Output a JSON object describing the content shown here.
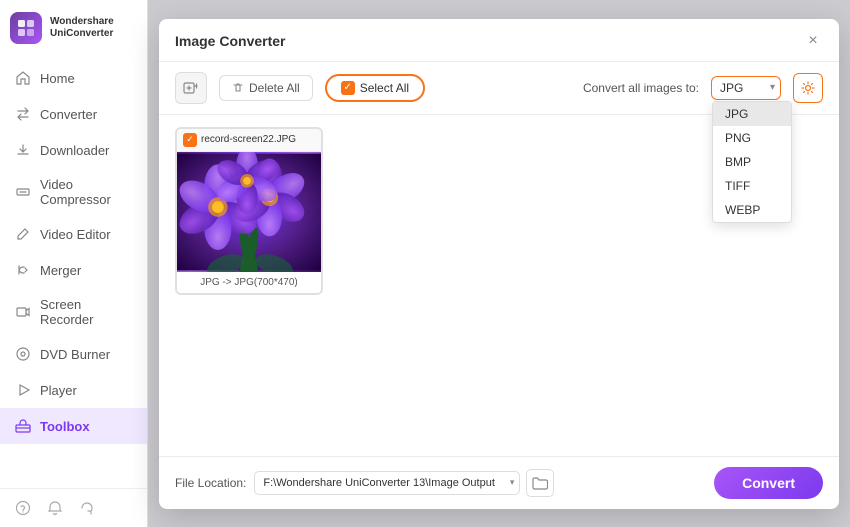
{
  "app": {
    "name": "Wondershare UniCon",
    "logo_letter": "W"
  },
  "sidebar": {
    "items": [
      {
        "id": "home",
        "label": "Home",
        "icon": "home"
      },
      {
        "id": "converter",
        "label": "Converter",
        "icon": "converter",
        "active": true
      },
      {
        "id": "downloader",
        "label": "Downloader",
        "icon": "downloader"
      },
      {
        "id": "video-compressor",
        "label": "Video Compressor",
        "icon": "compress"
      },
      {
        "id": "video-editor",
        "label": "Video Editor",
        "icon": "edit"
      },
      {
        "id": "merger",
        "label": "Merger",
        "icon": "merge"
      },
      {
        "id": "screen-recorder",
        "label": "Screen Recorder",
        "icon": "record"
      },
      {
        "id": "dvd-burner",
        "label": "DVD Burner",
        "icon": "dvd"
      },
      {
        "id": "player",
        "label": "Player",
        "icon": "play"
      },
      {
        "id": "toolbox",
        "label": "Toolbox",
        "icon": "toolbox",
        "active": true
      }
    ],
    "bottom_icons": [
      "help",
      "bell",
      "refresh"
    ]
  },
  "modal": {
    "title": "Image Converter",
    "close_label": "×",
    "toolbar": {
      "add_tooltip": "Add files",
      "delete_all_label": "Delete All",
      "select_all_label": "Select All",
      "convert_all_label": "Convert all images to:",
      "format_options": [
        "JPG",
        "PNG",
        "BMP",
        "TIFF",
        "WEBP"
      ],
      "selected_format": "JPG"
    },
    "images": [
      {
        "filename": "record-screen22.JPG",
        "label": "JPG -> JPG(700*470)"
      }
    ],
    "footer": {
      "label": "File Location:",
      "path": "F:\\Wondershare UniConverter 13\\Image Output",
      "convert_label": "Convert"
    }
  }
}
